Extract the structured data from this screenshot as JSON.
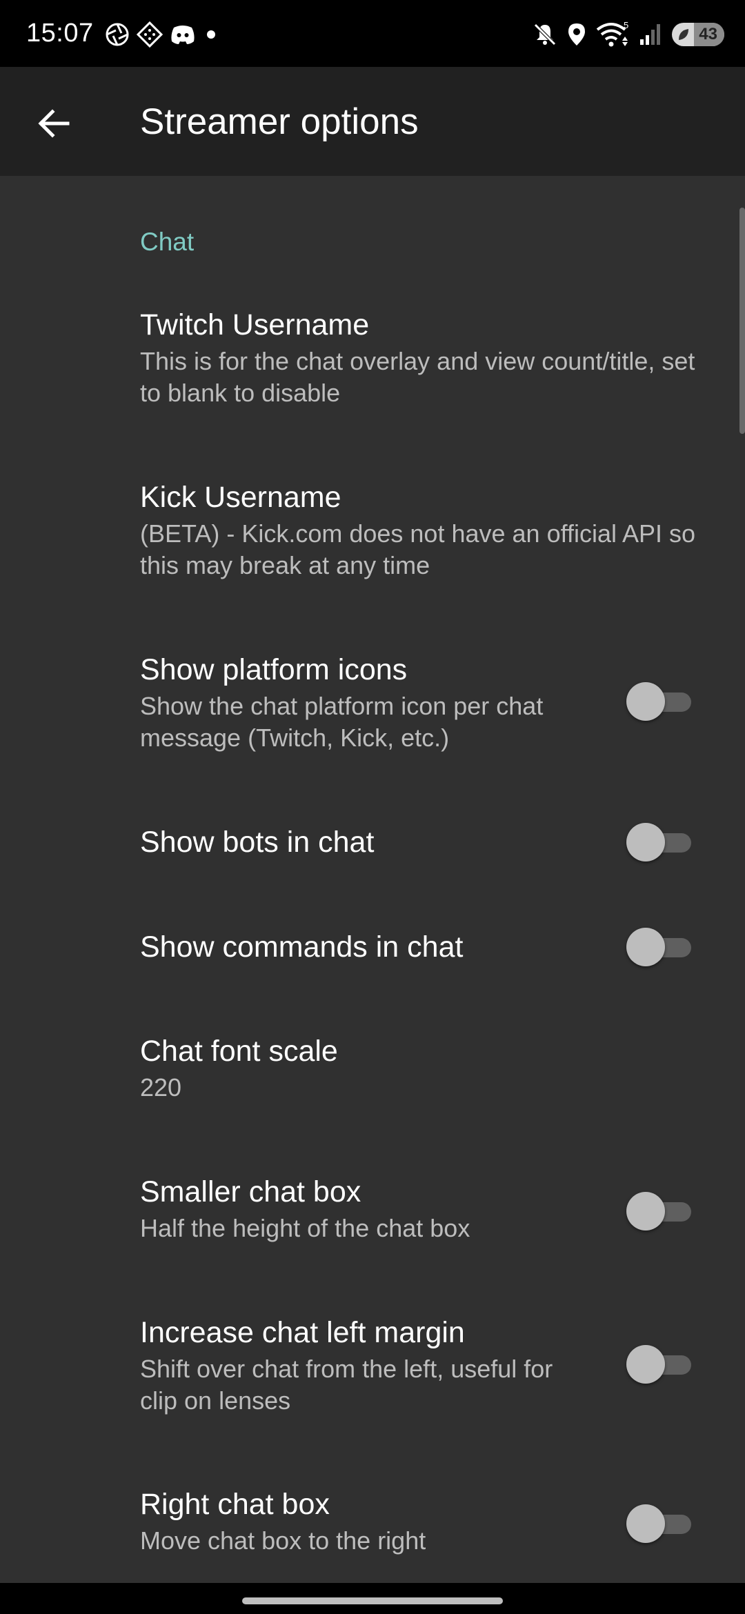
{
  "status_bar": {
    "time": "15:07",
    "left_icons": [
      "aperture-icon",
      "diamond-grid-icon",
      "discord-icon",
      "dot-icon"
    ],
    "right_icons": [
      "mute-icon",
      "location-icon",
      "wifi-icon",
      "signal-icon"
    ],
    "wifi_label": "5",
    "battery_level": "43"
  },
  "app_bar": {
    "title": "Streamer options",
    "back_icon": "arrow-back-icon"
  },
  "section": {
    "header": "Chat"
  },
  "preferences": [
    {
      "title": "Twitch Username",
      "summary": "This is for the chat overlay and view count/title, set to blank to disable"
    },
    {
      "title": "Kick Username",
      "summary": "(BETA) - Kick.com does not have an official API so this may break at any time"
    },
    {
      "title": "Show platform icons",
      "summary": "Show the chat platform icon per chat message (Twitch, Kick, etc.)",
      "enabled": false
    },
    {
      "title": "Show bots in chat",
      "enabled": false
    },
    {
      "title": "Show commands in chat",
      "enabled": false
    },
    {
      "title": "Chat font scale",
      "summary": "220"
    },
    {
      "title": "Smaller chat box",
      "summary": "Half the height of the chat box",
      "enabled": false
    },
    {
      "title": "Increase chat left margin",
      "summary": "Shift over chat from the left, useful for clip on lenses",
      "enabled": false
    },
    {
      "title": "Right chat box",
      "summary": "Move chat box to the right",
      "enabled": false
    }
  ],
  "colors": {
    "accent": "#80cbc4",
    "background": "#303030",
    "app_bar": "#212121",
    "switch_thumb_off": "#bdbdbd",
    "switch_track_off": "#5f5f5f"
  }
}
